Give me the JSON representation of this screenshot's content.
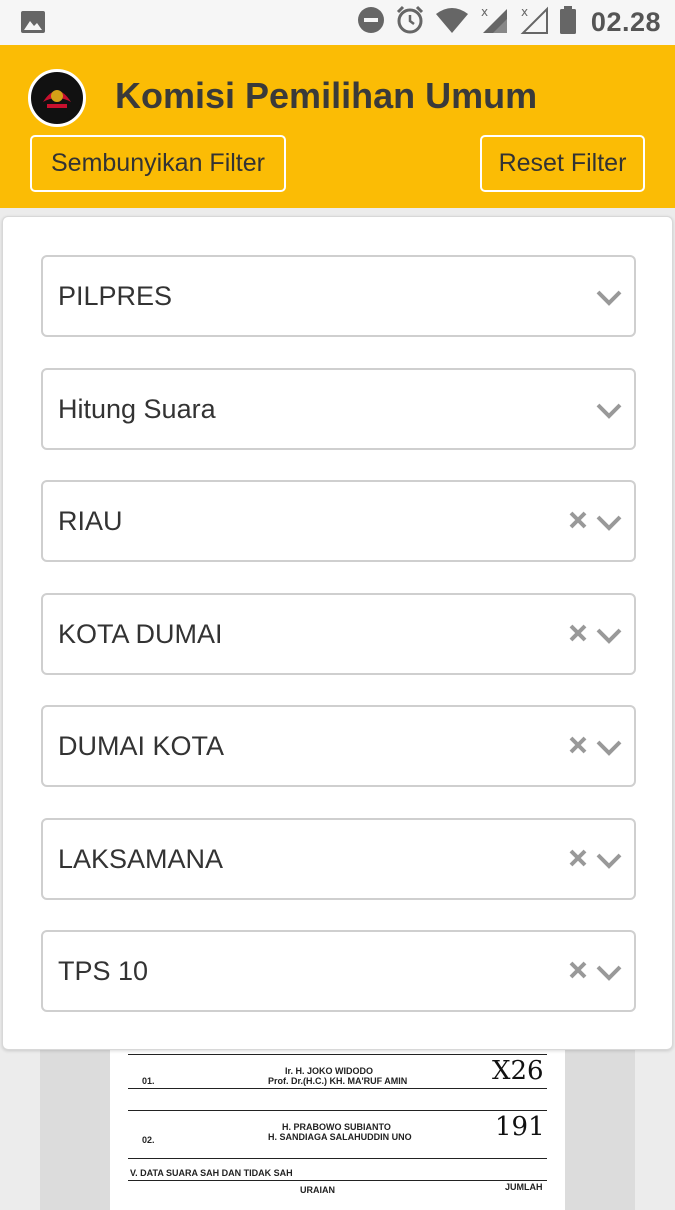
{
  "status_bar": {
    "time": "02.28",
    "icons": [
      "image-icon",
      "do-not-disturb-icon",
      "alarm-icon",
      "wifi-icon",
      "signal-x-icon",
      "signal-x-empty-icon",
      "battery-icon"
    ]
  },
  "header": {
    "title": "Komisi Pemilihan Umum",
    "logo": "kpu-logo",
    "hide_filter_label": "Sembunyikan Filter",
    "reset_filter_label": "Reset Filter",
    "background_color": "#fbbc05"
  },
  "filters": [
    {
      "value": "PILPRES",
      "clearable": false
    },
    {
      "value": "Hitung Suara",
      "clearable": false
    },
    {
      "value": "RIAU",
      "clearable": true
    },
    {
      "value": "KOTA DUMAI",
      "clearable": true
    },
    {
      "value": "DUMAI KOTA",
      "clearable": true
    },
    {
      "value": "LAKSAMANA",
      "clearable": true
    },
    {
      "value": "TPS 10",
      "clearable": true
    }
  ],
  "document_preview": {
    "rows": [
      {
        "no": "01.",
        "names": [
          "Ir. H. JOKO WIDODO",
          "Prof. Dr.(H.C.) KH. MA'RUF AMIN"
        ],
        "votes": "X26"
      },
      {
        "no": "02.",
        "names": [
          "H. PRABOWO SUBIANTO",
          "H. SANDIAGA SALAHUDDIN UNO"
        ],
        "votes": "191"
      }
    ],
    "section_title": "V. DATA SUARA SAH DAN TIDAK SAH",
    "col_uraian": "URAIAN",
    "col_jumlah": "JUMLAH"
  }
}
